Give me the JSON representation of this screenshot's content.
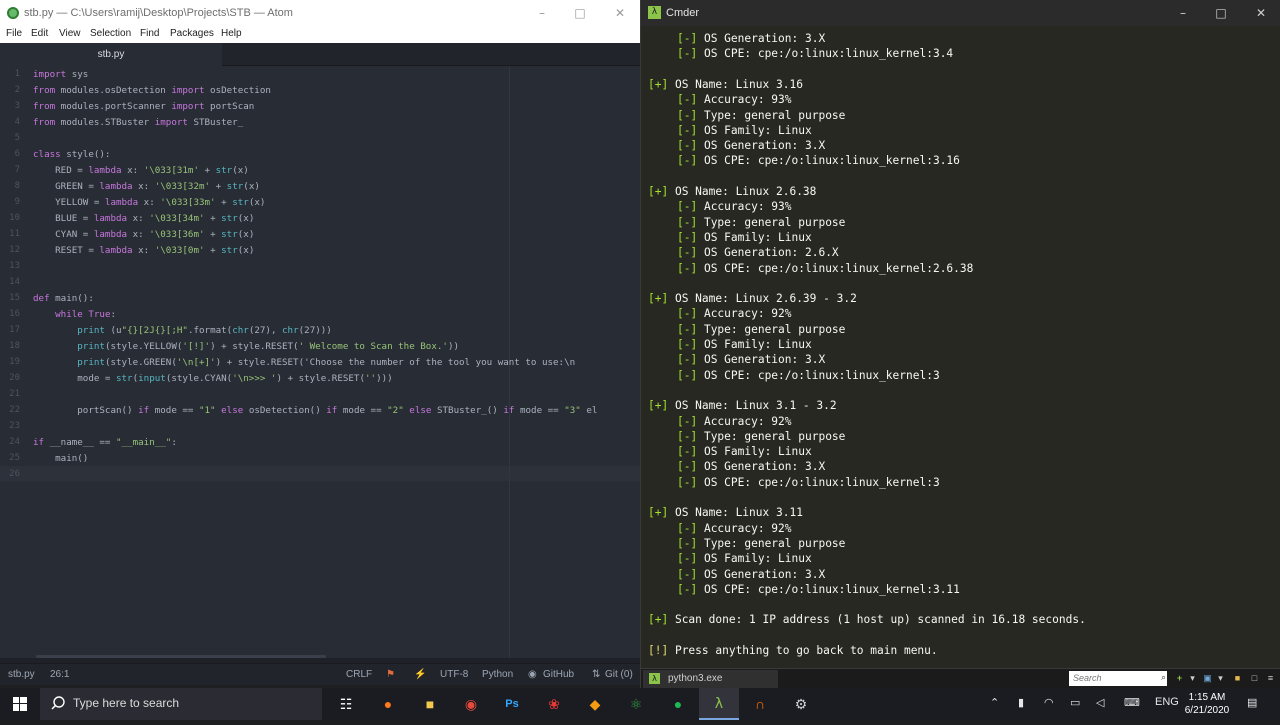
{
  "atom": {
    "title": "stb.py — C:\\Users\\ramij\\Desktop\\Projects\\STB — Atom",
    "menu": [
      "File",
      "Edit",
      "View",
      "Selection",
      "Find",
      "Packages",
      "Help"
    ],
    "tab": "stb.py",
    "status": {
      "file": "stb.py",
      "cursor": "26:1",
      "line_ending": "CRLF",
      "encoding": "UTF-8",
      "grammar": "Python",
      "github": "GitHub",
      "git": "Git (0)"
    },
    "code_lines": [
      "import sys",
      "from modules.osDetection import osDetection",
      "from modules.portScanner import portScan",
      "from modules.STBuster import STBuster_",
      "",
      "class style():",
      "    RED = lambda x: '\\033[31m' + str(x)",
      "    GREEN = lambda x: '\\033[32m' + str(x)",
      "    YELLOW = lambda x: '\\033[33m' + str(x)",
      "    BLUE = lambda x: '\\033[34m' + str(x)",
      "    CYAN = lambda x: '\\033[36m' + str(x)",
      "    RESET = lambda x: '\\033[0m' + str(x)",
      "",
      "",
      "def main():",
      "    while True:",
      "        print (u\"{}[2J{}[;H\".format(chr(27), chr(27)))",
      "        print(style.YELLOW('[!]') + style.RESET(' Welcome to Scan the Box.'))",
      "        print(style.GREEN('\\n[+]') + style.RESET('Choose the number of the tool you want to use:\\n",
      "        mode = str(input(style.CYAN('\\n>>> ') + style.RESET('')))",
      "",
      "        portScan() if mode == \"1\" else osDetection() if mode == \"2\" else STBuster_() if mode == \"3\" el",
      "",
      "if __name__ == \"__main__\":",
      "    main()",
      ""
    ]
  },
  "cmder": {
    "title": "Cmder",
    "tab_label": "python3.exe",
    "search_placeholder": "Search",
    "terminal": {
      "os_partial": [
        {
          "tag": "[-]",
          "text": " OS Generation: 3.X"
        },
        {
          "tag": "[-]",
          "text": " OS CPE: cpe:/o:linux:linux_kernel:3.4"
        }
      ],
      "os_entries": [
        {
          "name": "Linux 3.16",
          "accuracy": "93%",
          "type": "general purpose",
          "family": "Linux",
          "generation": "3.X",
          "cpe": "cpe:/o:linux:linux_kernel:3.16"
        },
        {
          "name": "Linux 2.6.38",
          "accuracy": "93%",
          "type": "general purpose",
          "family": "Linux",
          "generation": "2.6.X",
          "cpe": "cpe:/o:linux:linux_kernel:2.6.38"
        },
        {
          "name": "Linux 2.6.39 - 3.2",
          "accuracy": "92%",
          "type": "general purpose",
          "family": "Linux",
          "generation": "3.X",
          "cpe": "cpe:/o:linux:linux_kernel:3"
        },
        {
          "name": "Linux 3.1 - 3.2",
          "accuracy": "92%",
          "type": "general purpose",
          "family": "Linux",
          "generation": "3.X",
          "cpe": "cpe:/o:linux:linux_kernel:3"
        },
        {
          "name": "Linux 3.11",
          "accuracy": "92%",
          "type": "general purpose",
          "family": "Linux",
          "generation": "3.X",
          "cpe": "cpe:/o:linux:linux_kernel:3.11"
        }
      ],
      "labels": {
        "name": " OS Name: ",
        "accuracy": " Accuracy: ",
        "type": " Type: ",
        "family": " OS Family: ",
        "generation": " OS Generation: ",
        "cpe": " OS CPE: "
      },
      "scan_done": {
        "tag": "[+]",
        "text": " Scan done: 1 IP address (1 host up) scanned in 16.18 seconds."
      },
      "prompt": {
        "tag": "[!]",
        "text": " Press anything to go back to main menu."
      }
    }
  },
  "taskbar": {
    "search_placeholder": "Type here to search",
    "tray_lang": "ENG",
    "time": "1:15 AM",
    "date": "6/21/2020"
  },
  "colors": {
    "atom_bg": "#282c34",
    "cmder_bg": "#272822",
    "term_tag_green": "#a6e22e",
    "term_tag_yellow": "#e6db74",
    "taskbar_bg": "#1b1b22"
  }
}
